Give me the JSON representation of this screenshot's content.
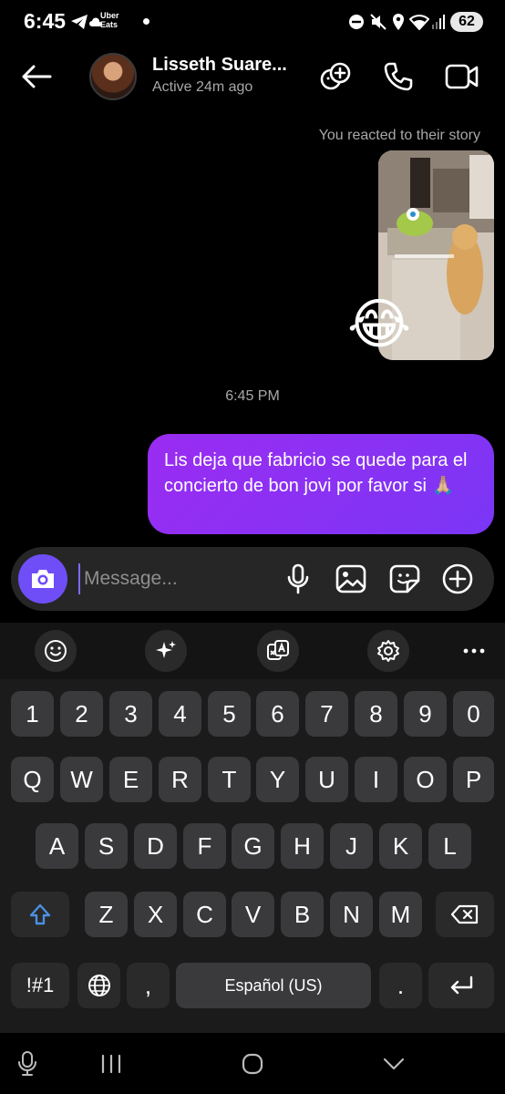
{
  "status_bar": {
    "time": "6:45",
    "uber_eats": "Uber\nEats",
    "battery": "62"
  },
  "header": {
    "contact_name": "Lisseth Suare...",
    "contact_status": "Active 24m ago",
    "icons": [
      "back-arrow-icon",
      "add-people-icon",
      "phone-icon",
      "video-icon"
    ]
  },
  "chat": {
    "reaction_caption": "You reacted to their story",
    "story_emoji": "😂",
    "timestamp": "6:45 PM",
    "message": "Lis deja que fabricio se quede para el concierto de bon jovi por favor si 🙏🏼"
  },
  "composer": {
    "placeholder": "Message..."
  },
  "keyboard": {
    "number_row": [
      "1",
      "2",
      "3",
      "4",
      "5",
      "6",
      "7",
      "8",
      "9",
      "0"
    ],
    "row1": [
      "Q",
      "W",
      "E",
      "R",
      "T",
      "Y",
      "U",
      "I",
      "O",
      "P"
    ],
    "row2": [
      "A",
      "S",
      "D",
      "F",
      "G",
      "H",
      "J",
      "K",
      "L"
    ],
    "row3": [
      "Z",
      "X",
      "C",
      "V",
      "B",
      "N",
      "M"
    ],
    "symbols_key": "!#1",
    "comma_key": ",",
    "space_label": "Español (US)",
    "period_key": "."
  },
  "colors": {
    "bubble_start": "#9b2cf2",
    "bubble_end": "#7a36f5",
    "camera_button": "#6f4ef7",
    "shift_active": "#4a90e2"
  }
}
